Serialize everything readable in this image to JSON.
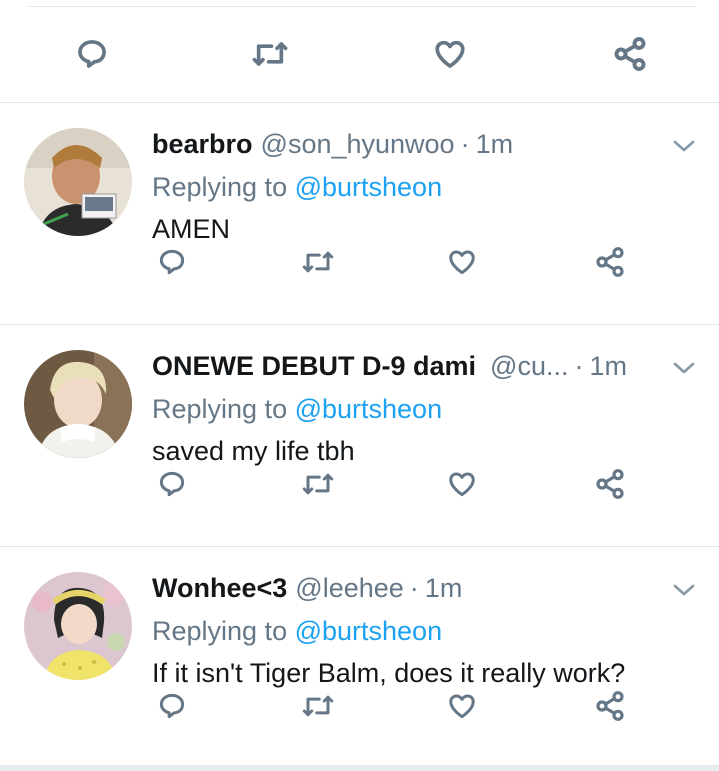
{
  "colors": {
    "name": "#14171a",
    "secondary": "#657786",
    "link": "#1da1f2",
    "divider": "#e1e8ed"
  },
  "top_actions": [
    "reply-icon",
    "retweet-icon",
    "like-icon",
    "share-icon"
  ],
  "tweets": [
    {
      "display_name": "bearbro",
      "handle": "@son_hyunwoo",
      "separator": "·",
      "time": "1m",
      "replying_prefix": "Replying to ",
      "replying_to": "@burtsheon",
      "text": "AMEN",
      "avatar_colors": [
        "#b08060",
        "#2d2d2d"
      ]
    },
    {
      "display_name": "ONEWE DEBUT D-9 dami",
      "handle": "@cu...",
      "separator": "·",
      "time": "1m",
      "replying_prefix": "Replying to ",
      "replying_to": "@burtsheon",
      "text": "saved my life tbh",
      "avatar_colors": [
        "#d8cfb8",
        "#f2f2f2"
      ]
    },
    {
      "display_name": "Wonhee<3",
      "handle": "@leehee",
      "separator": "·",
      "time": "1m",
      "replying_prefix": "Replying to ",
      "replying_to": "@burtsheon",
      "text": "If it isn't Tiger Balm, does it really work?",
      "avatar_colors": [
        "#2a2a2a",
        "#e6d36a"
      ]
    }
  ]
}
